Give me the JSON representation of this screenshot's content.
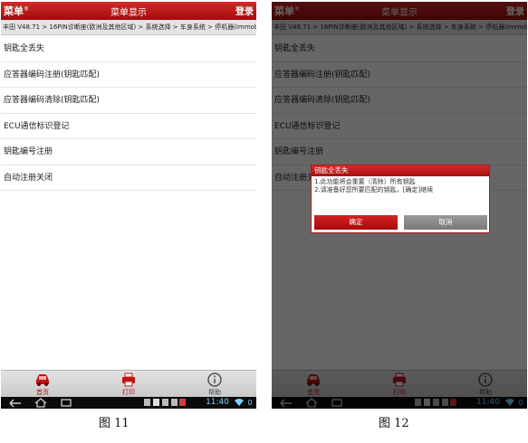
{
  "app": {
    "menu_label": "菜单",
    "menu_mark": "®",
    "title": "菜单显示",
    "login_label": "登录"
  },
  "breadcrumb": "丰田 V48.71 > 16PIN诊断座(欧洲及其他区域) > 系统选择 > 车身系统 > 停机器(Immobiliser)",
  "menu_items": [
    "钥匙全丢失",
    "应答器编码注册(钥匙匹配)",
    "应答器编码清除(钥匙匹配)",
    "ECU通信标识登记",
    "钥匙编号注册",
    "自动注册关闭"
  ],
  "bottom_nav": {
    "home": "首页",
    "print": "打印",
    "help": "帮助"
  },
  "status_bar": {
    "time": "11:40",
    "battery_level": "0"
  },
  "dialog": {
    "title": "钥匙全丢失",
    "line1": "1.此功能将会重置（清除）所有钥匙",
    "line2": "2.请准备好您所要匹配的钥匙，[确定]继续",
    "ok_label": "确定",
    "cancel_label": "取消"
  },
  "captions": {
    "left": "图 11",
    "right": "图 12"
  },
  "colors": {
    "brand_red": "#b81515",
    "nav_bg": "#d6d6d6",
    "sysbar_bg": "#0b0b0b"
  }
}
